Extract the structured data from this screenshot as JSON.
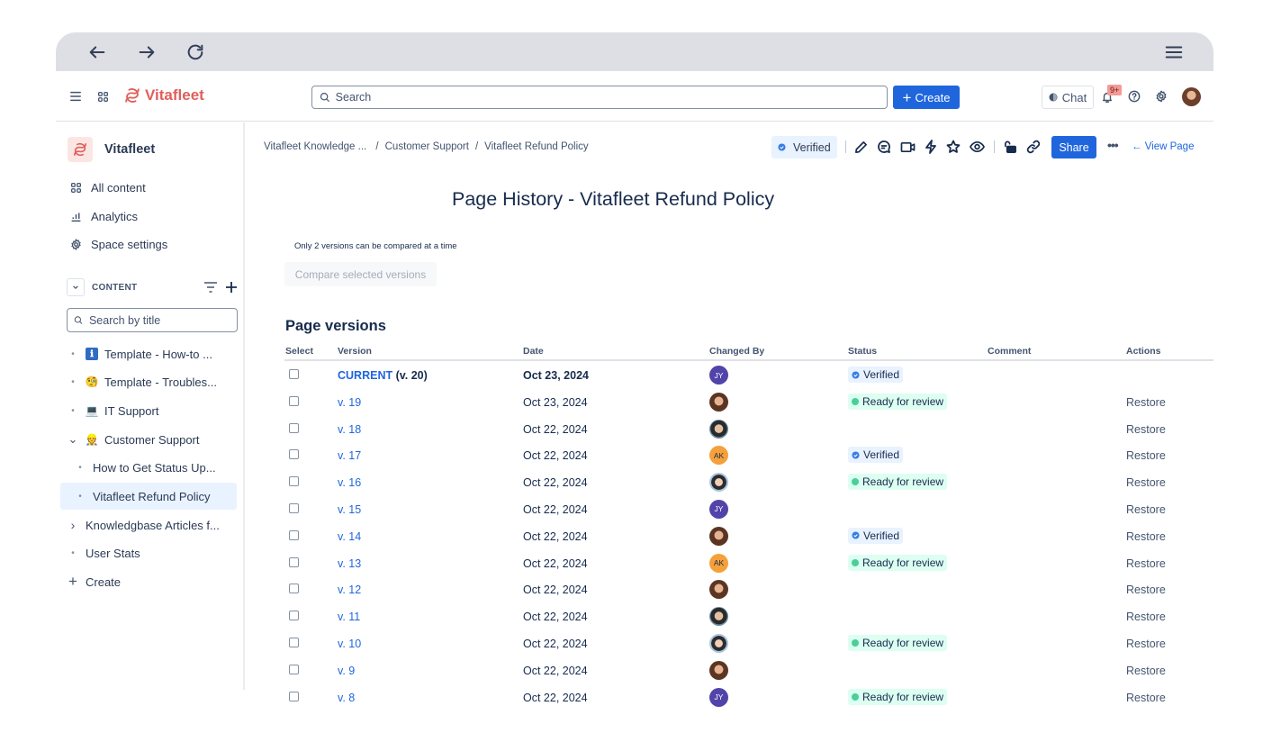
{
  "browser": {
    "back_icon": "arrow-left-icon",
    "forward_icon": "arrow-right-icon",
    "reload_icon": "reload-icon",
    "menu_icon": "hamburger-menu-icon"
  },
  "header": {
    "brand": "Vitafleet",
    "search_placeholder": "Search",
    "create_label": "Create",
    "chat_label": "Chat",
    "notifications_badge": "9+"
  },
  "sidebar": {
    "space_name": "Vitafleet",
    "nav": [
      {
        "label": "All content",
        "icon": "grid-icon"
      },
      {
        "label": "Analytics",
        "icon": "analytics-icon"
      },
      {
        "label": "Space settings",
        "icon": "gear-icon"
      }
    ],
    "content_label": "CONTENT",
    "search_placeholder": "Search by title",
    "tree": [
      {
        "label": "Template - How-to ...",
        "prefix": "•",
        "emoji": "ℹ",
        "indent": 0
      },
      {
        "label": "Template - Troubles...",
        "prefix": "•",
        "emoji": "🧐",
        "indent": 0
      },
      {
        "label": "IT Support",
        "prefix": "•",
        "emoji": "💻",
        "indent": 0
      },
      {
        "label": "Customer Support",
        "prefix": "⌄",
        "emoji": "👷",
        "indent": 0
      },
      {
        "label": "How to Get Status Up...",
        "prefix": "•",
        "emoji": "",
        "indent": 1
      },
      {
        "label": "Vitafleet Refund Policy",
        "prefix": "•",
        "emoji": "",
        "indent": 1,
        "selected": true
      },
      {
        "label": "Knowledgbase Articles f...",
        "prefix": "›",
        "emoji": "",
        "indent": 0
      },
      {
        "label": "User Stats",
        "prefix": "•",
        "emoji": "",
        "indent": 0
      },
      {
        "label": "Create",
        "prefix": "+",
        "emoji": "",
        "indent": 0
      }
    ]
  },
  "breadcrumb": [
    "Vitafleet Knowledge ...",
    "Customer Support",
    "Vitafleet Refund Policy"
  ],
  "toolbar": {
    "status_label": "Verified",
    "share_label": "Share",
    "more_label": "•••",
    "view_page_label": "← View Page"
  },
  "main": {
    "title": "Page History - Vitafleet Refund Policy",
    "compare_note": "Only 2 versions can be compared at a time",
    "compare_button": "Compare selected versions",
    "section_title": "Page versions",
    "columns": [
      "Select",
      "Version",
      "Date",
      "Changed By",
      "Status",
      "Comment",
      "Actions"
    ],
    "rows": [
      {
        "version": "CURRENT",
        "suffix": " (v. 20)",
        "date": "Oct 23, 2024",
        "author": "JY",
        "author_type": "initials",
        "author_color": "#5243aa",
        "status": "Verified",
        "comment": "",
        "action": ""
      },
      {
        "version": "v. 19",
        "date": "Oct 23, 2024",
        "author": "photo-a",
        "author_type": "photo",
        "status": "Ready for review",
        "comment": "",
        "action": "Restore"
      },
      {
        "version": "v. 18",
        "date": "Oct 22, 2024",
        "author": "photo-b",
        "author_type": "photo",
        "status": "",
        "comment": "",
        "action": "Restore"
      },
      {
        "version": "v. 17",
        "date": "Oct 22, 2024",
        "author": "AK",
        "author_type": "initials",
        "author_color": "#f5a03b",
        "status": "Verified",
        "comment": "",
        "action": "Restore"
      },
      {
        "version": "v. 16",
        "date": "Oct 22, 2024",
        "author": "photo-c",
        "author_type": "photo",
        "status": "Ready for review",
        "comment": "",
        "action": "Restore"
      },
      {
        "version": "v. 15",
        "date": "Oct 22, 2024",
        "author": "JY",
        "author_type": "initials",
        "author_color": "#5243aa",
        "status": "",
        "comment": "",
        "action": "Restore"
      },
      {
        "version": "v. 14",
        "date": "Oct 22, 2024",
        "author": "photo-a",
        "author_type": "photo",
        "status": "Verified",
        "comment": "",
        "action": "Restore"
      },
      {
        "version": "v. 13",
        "date": "Oct 22, 2024",
        "author": "AK",
        "author_type": "initials",
        "author_color": "#f5a03b",
        "status": "Ready for review",
        "comment": "",
        "action": "Restore"
      },
      {
        "version": "v. 12",
        "date": "Oct 22, 2024",
        "author": "photo-a",
        "author_type": "photo",
        "status": "",
        "comment": "",
        "action": "Restore"
      },
      {
        "version": "v. 11",
        "date": "Oct 22, 2024",
        "author": "photo-b",
        "author_type": "photo",
        "status": "",
        "comment": "",
        "action": "Restore"
      },
      {
        "version": "v. 10",
        "date": "Oct 22, 2024",
        "author": "photo-c",
        "author_type": "photo",
        "status": "Ready for review",
        "comment": "",
        "action": "Restore"
      },
      {
        "version": "v. 9",
        "date": "Oct 22, 2024",
        "author": "photo-a",
        "author_type": "photo",
        "status": "",
        "comment": "",
        "action": "Restore"
      },
      {
        "version": "v. 8",
        "date": "Oct 22, 2024",
        "author": "JY",
        "author_type": "initials",
        "author_color": "#5243aa",
        "status": "Ready for review",
        "comment": "",
        "action": "Restore"
      }
    ]
  },
  "colors": {
    "brand": "#e05f5b",
    "primary": "#1f66dd",
    "verified_bg": "#e9f2ff",
    "review_bg": "#dcfff1",
    "review_dot": "#4bce97"
  }
}
